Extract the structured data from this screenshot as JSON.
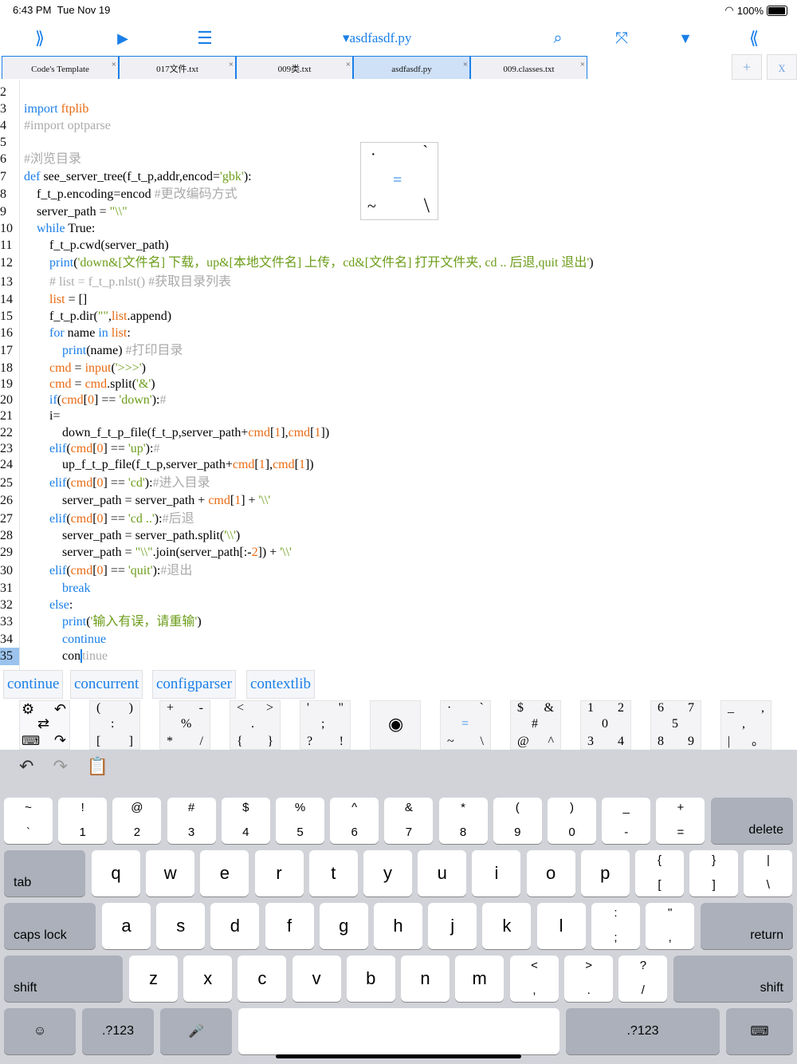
{
  "status": {
    "time": "6:43 PM",
    "date": "Tue Nov 19",
    "battery": "100%"
  },
  "toolbar": {
    "expand_right": "⟫",
    "run": "▶",
    "list": "☰",
    "title": "▾asdfasdf.py",
    "search": "⌕",
    "collapse": "⤧",
    "dropdown": "▼",
    "expand_left": "⟪"
  },
  "tabs": [
    {
      "label": "Code's Template",
      "close": "×"
    },
    {
      "label": "017文件.txt",
      "close": "×"
    },
    {
      "label": "009类.txt",
      "close": "×"
    },
    {
      "label": "asdfasdf.py",
      "close": "×"
    },
    {
      "label": "009.classes.txt",
      "close": "×"
    }
  ],
  "tab_buttons": {
    "add": "+",
    "close": "x"
  },
  "code_lines": [
    {
      "n": "2",
      "html": ""
    },
    {
      "n": "3",
      "html": "<span class='kw'>import</span> <span class='vr'>ftplib</span>"
    },
    {
      "n": "4",
      "html": "<span class='cm'>#import optparse</span>"
    },
    {
      "n": "5",
      "html": ""
    },
    {
      "n": "6",
      "html": "<span class='cm'>#浏览目录</span>"
    },
    {
      "n": "7",
      "html": "<span class='kw'>def</span> see_server_tree(f_t_p,addr,encod=<span class='st'>'gbk'</span>):"
    },
    {
      "n": "8",
      "html": "    f_t_p.encoding=encod <span class='cm'>#更改编码方式</span>"
    },
    {
      "n": "9",
      "html": "    server_path = <span class='st'>\"\\\\\"</span>"
    },
    {
      "n": "10",
      "html": "    <span class='kw'>while</span> True:"
    },
    {
      "n": "11",
      "html": "        f_t_p.cwd(server_path)"
    },
    {
      "n": "12",
      "html": "        <span class='kw'>print</span>(<span class='st'>'down&amp;[文件名] 下载，up&amp;[本地文件名] 上传，cd&amp;[文件名] 打开文件夹, cd .. 后退,quit 退出'</span>)"
    },
    {
      "n": "13",
      "html": "        <span class='cm'># list = f_t_p.nlst() #获取目录列表</span>"
    },
    {
      "n": "14",
      "html": "        <span class='vr'>list</span> = []"
    },
    {
      "n": "15",
      "html": "        f_t_p.dir(<span class='st'>\"\"</span>,<span class='vr'>list</span>.append)"
    },
    {
      "n": "16",
      "html": "        <span class='kw'>for</span> name <span class='kw'>in</span> <span class='vr'>list</span>:"
    },
    {
      "n": "17",
      "html": "            <span class='kw'>print</span>(name) <span class='cm'>#打印目录</span>"
    },
    {
      "n": "18",
      "html": "        <span class='vr'>cmd</span> = <span class='vr'>input</span>(<span class='st'>'&gt;&gt;&gt;'</span>)"
    },
    {
      "n": "19",
      "html": "        <span class='vr'>cmd</span> = <span class='vr'>cmd</span>.split(<span class='st'>'&amp;'</span>)"
    },
    {
      "n": "20",
      "html": "        <span class='kw'>if</span>(<span class='vr'>cmd</span>[<span class='nm'>0</span>] == <span class='st'>'down'</span>):<span class='cm'>#</span>"
    },
    {
      "n": "21",
      "html": "        i="
    },
    {
      "n": "22",
      "html": "            down_f_t_p_file(f_t_p,server_path+<span class='vr'>cmd</span>[<span class='nm'>1</span>],<span class='vr'>cmd</span>[<span class='nm'>1</span>])"
    },
    {
      "n": "23",
      "html": "        <span class='kw'>elif</span>(<span class='vr'>cmd</span>[<span class='nm'>0</span>] == <span class='st'>'up'</span>):<span class='cm'>#</span>"
    },
    {
      "n": "24",
      "html": "            up_f_t_p_file(f_t_p,server_path+<span class='vr'>cmd</span>[<span class='nm'>1</span>],<span class='vr'>cmd</span>[<span class='nm'>1</span>])"
    },
    {
      "n": "25",
      "html": "        <span class='kw'>elif</span>(<span class='vr'>cmd</span>[<span class='nm'>0</span>] == <span class='st'>'cd'</span>):<span class='cm'>#进入目录</span>"
    },
    {
      "n": "26",
      "html": "            server_path = server_path + <span class='vr'>cmd</span>[<span class='nm'>1</span>] + <span class='st'>'\\\\'</span>"
    },
    {
      "n": "27",
      "html": "        <span class='kw'>elif</span>(<span class='vr'>cmd</span>[<span class='nm'>0</span>] == <span class='st'>'cd ..'</span>):<span class='cm'>#后退</span>"
    },
    {
      "n": "28",
      "html": "            server_path = server_path.split(<span class='st'>'\\\\'</span>)"
    },
    {
      "n": "29",
      "html": "            server_path = <span class='st'>\"\\\\\"</span>.join(server_path[:-<span class='nm'>2</span>]) + <span class='st'>'\\\\'</span>"
    },
    {
      "n": "30",
      "html": "        <span class='kw'>elif</span>(<span class='vr'>cmd</span>[<span class='nm'>0</span>] == <span class='st'>'quit'</span>):<span class='cm'>#退出</span>"
    },
    {
      "n": "31",
      "html": "            <span class='kw'>break</span>"
    },
    {
      "n": "32",
      "html": "        <span class='kw'>else</span>:"
    },
    {
      "n": "33",
      "html": "            <span class='kw'>print</span>(<span class='st'>'输入有误，请重输'</span>)"
    },
    {
      "n": "34",
      "html": "            <span class='kw'>continue</span>"
    },
    {
      "n": "35",
      "html": "            con<span style='border-left:2px solid #1a7fe8'></span><span class='cm'>tinue</span>"
    }
  ],
  "popup": {
    "tl": "·",
    "tr": "`",
    "mid": "=",
    "bl": "~",
    "br": "\\"
  },
  "suggestions": [
    "continue",
    "concurrent",
    "configparser",
    "contextlib"
  ],
  "symbol_keys": [
    {
      "tl": "(",
      "tr": ")",
      "c": ":",
      "bl": "[",
      "br": "]"
    },
    {
      "tl": "+",
      "tr": "-",
      "c": "%",
      "bl": "*",
      "br": "/"
    },
    {
      "tl": "<",
      "tr": ">",
      "c": ".",
      "bl": "{",
      "br": "}"
    },
    {
      "tl": "'",
      "tr": "\"",
      "c": ";",
      "bl": "?",
      "br": "!"
    },
    {
      "tl": "",
      "tr": "",
      "c": "◉",
      "bl": "",
      "br": ""
    },
    {
      "tl": "·",
      "tr": "`",
      "c": "=",
      "bl": "~",
      "br": "\\"
    },
    {
      "tl": "$",
      "tr": "&",
      "c": "#",
      "bl": "@",
      "br": "^"
    },
    {
      "tl": "1",
      "tr": "2",
      "c": "0",
      "bl": "3",
      "br": "4"
    },
    {
      "tl": "6",
      "tr": "7",
      "c": "5",
      "bl": "8",
      "br": "9"
    },
    {
      "tl": "_",
      "tr": ",",
      "c": ",",
      "bl": "|",
      "br": "。"
    }
  ],
  "keyboard": {
    "num_row": [
      {
        "t": "~",
        "b": "`"
      },
      {
        "t": "!",
        "b": "1"
      },
      {
        "t": "@",
        "b": "2"
      },
      {
        "t": "#",
        "b": "3"
      },
      {
        "t": "$",
        "b": "4"
      },
      {
        "t": "%",
        "b": "5"
      },
      {
        "t": "^",
        "b": "6"
      },
      {
        "t": "&",
        "b": "7"
      },
      {
        "t": "*",
        "b": "8"
      },
      {
        "t": "(",
        "b": "9"
      },
      {
        "t": ")",
        "b": "0"
      },
      {
        "t": "_",
        "b": "-"
      },
      {
        "t": "+",
        "b": "="
      }
    ],
    "delete": "delete",
    "tab": "tab",
    "row_q": [
      "q",
      "w",
      "e",
      "r",
      "t",
      "y",
      "u",
      "i",
      "o",
      "p"
    ],
    "row_q_sym": [
      {
        "t": "{",
        "b": "["
      },
      {
        "t": "}",
        "b": "]"
      },
      {
        "t": "|",
        "b": "\\"
      }
    ],
    "caps": "caps lock",
    "row_a": [
      "a",
      "s",
      "d",
      "f",
      "g",
      "h",
      "j",
      "k",
      "l"
    ],
    "row_a_sym": [
      {
        "t": ":",
        "b": ";"
      },
      {
        "t": "\"",
        "b": ","
      }
    ],
    "return": "return",
    "shift": "shift",
    "row_z": [
      "z",
      "x",
      "c",
      "v",
      "b",
      "n",
      "m"
    ],
    "row_z_sym": [
      {
        "t": "<",
        "b": ","
      },
      {
        "t": ">",
        "b": "."
      },
      {
        "t": "?",
        "b": "/"
      }
    ],
    "emoji": "☺",
    "num_mode": ".?123",
    "mic": "🎤",
    "kb_hide": "⌨"
  }
}
